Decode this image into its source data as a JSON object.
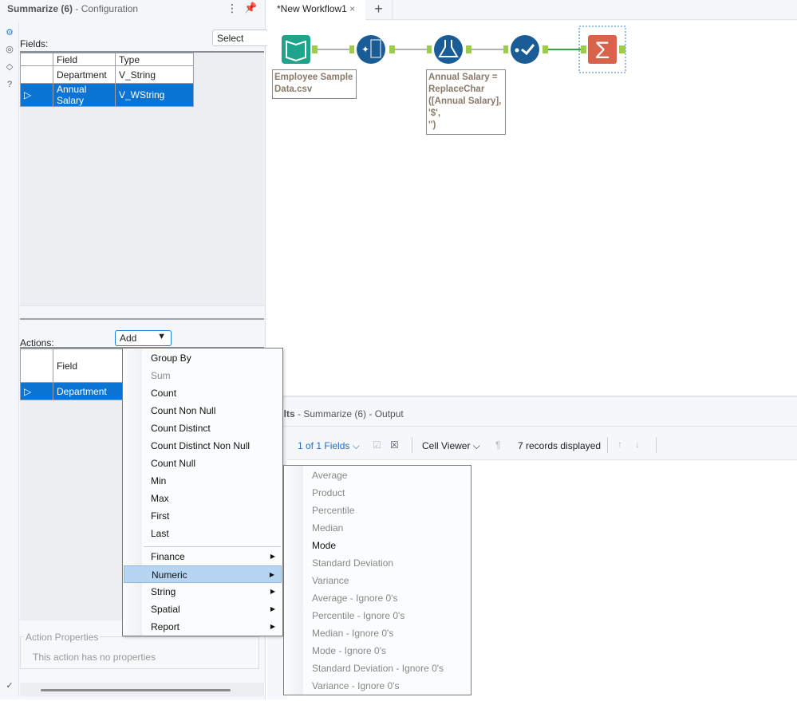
{
  "config_panel": {
    "title": "Summarize (6)",
    "subtitle": "- Configuration",
    "select_label": "Select",
    "fields_label": "Fields:",
    "fields_headers": [
      "Field",
      "Type"
    ],
    "fields_rows": [
      {
        "field": "Department",
        "type": "V_String"
      },
      {
        "field": "Annual Salary",
        "type": "V_WString"
      }
    ],
    "actions_label": "Actions:",
    "add_label": "Add",
    "actions_header": "Field",
    "actions_rows": [
      "Department"
    ],
    "action_properties_title": "Action Properties",
    "action_properties_text": "This action has no properties"
  },
  "tabs": {
    "active": "*New Workflow1",
    "close": "×",
    "add": "+"
  },
  "workflow": {
    "input_annotation": "Employee Sample Data.csv",
    "formula_annotation": [
      "Annual Salary =",
      "ReplaceChar",
      "([Annual Salary],",
      "'$',",
      "'')"
    ],
    "accent": "#1a5c96",
    "input_color": "#1fa38b",
    "summarize_color": "#d9624a"
  },
  "results": {
    "title": "esults",
    "subtitle": "- Summarize (6) - Output",
    "fields": "1 of 1 Fields",
    "cell_viewer": "Cell Viewer",
    "records": "7 records displayed"
  },
  "menu": {
    "items": [
      {
        "label": "Group By",
        "disabled": false
      },
      {
        "label": "Sum",
        "disabled": true
      },
      {
        "label": "Count",
        "disabled": false
      },
      {
        "label": "Count Non Null",
        "disabled": false
      },
      {
        "label": "Count Distinct",
        "disabled": false
      },
      {
        "label": "Count Distinct Non Null",
        "disabled": false
      },
      {
        "label": "Count Null",
        "disabled": false
      },
      {
        "label": "Min",
        "disabled": false
      },
      {
        "label": "Max",
        "disabled": false
      },
      {
        "label": "First",
        "disabled": false
      },
      {
        "label": "Last",
        "disabled": false
      }
    ],
    "submenus": [
      {
        "label": "Finance"
      },
      {
        "label": "Numeric",
        "highlighted": true
      },
      {
        "label": "String"
      },
      {
        "label": "Spatial"
      },
      {
        "label": "Report"
      }
    ]
  },
  "numeric_submenu": [
    {
      "label": "Average",
      "disabled": true
    },
    {
      "label": "Product",
      "disabled": true
    },
    {
      "label": "Percentile",
      "disabled": true
    },
    {
      "label": "Median",
      "disabled": true
    },
    {
      "label": "Mode",
      "disabled": false
    },
    {
      "label": "Standard Deviation",
      "disabled": true
    },
    {
      "label": "Variance",
      "disabled": true
    },
    {
      "label": "Average - Ignore 0's",
      "disabled": true
    },
    {
      "label": "Percentile - Ignore 0's",
      "disabled": true
    },
    {
      "label": "Median - Ignore 0's",
      "disabled": true
    },
    {
      "label": "Mode - Ignore 0's",
      "disabled": true
    },
    {
      "label": "Standard Deviation - Ignore 0's",
      "disabled": true
    },
    {
      "label": "Variance - Ignore 0's",
      "disabled": true
    }
  ]
}
